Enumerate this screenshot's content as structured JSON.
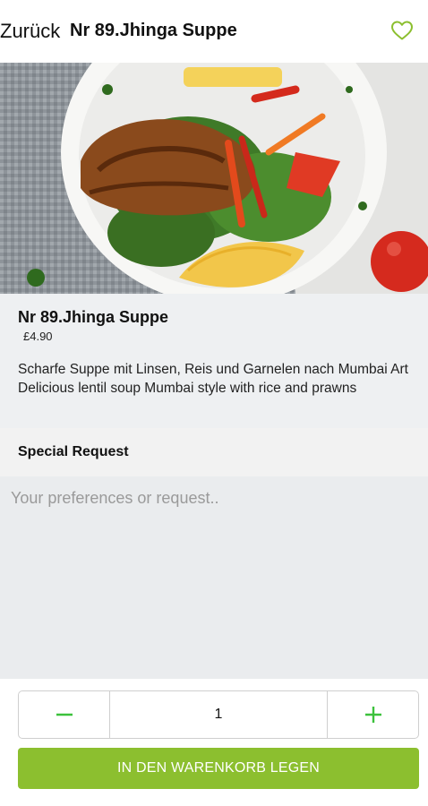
{
  "header": {
    "back_label": "Zurück",
    "title": "Nr 89.Jhinga Suppe",
    "favorite_icon": "heart-outline-icon"
  },
  "colors": {
    "accent": "#8cbf2f",
    "stepper_icons": "#3cc13c",
    "info_background": "#eef0f2"
  },
  "product": {
    "name": "Nr 89.Jhinga Suppe",
    "price": "£4.90",
    "description": "Scharfe Suppe mit Linsen, Reis und Garnelen nach Mumbai Art Delicious lentil soup Mumbai style with rice and prawns"
  },
  "special_request": {
    "label": "Special Request",
    "placeholder": "Your preferences or request.."
  },
  "quantity": {
    "value": "1",
    "decrease_icon": "minus-icon",
    "increase_icon": "plus-icon"
  },
  "cart_button": {
    "label": "IN DEN WARENKORB LEGEN"
  }
}
